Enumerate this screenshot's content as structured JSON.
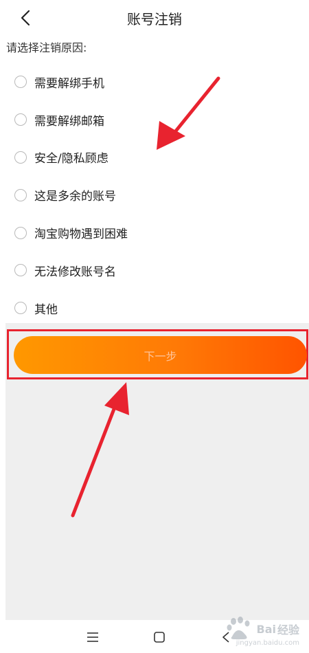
{
  "header": {
    "title": "账号注销",
    "back_icon": "chevron-left-icon"
  },
  "prompt": "请选择注销原因:",
  "options": [
    {
      "label": "需要解绑手机",
      "selected": false
    },
    {
      "label": "需要解绑邮箱",
      "selected": false
    },
    {
      "label": "安全/隐私顾虑",
      "selected": false
    },
    {
      "label": "这是多余的账号",
      "selected": false
    },
    {
      "label": "淘宝购物遇到困难",
      "selected": false
    },
    {
      "label": "无法修改账号名",
      "selected": false
    },
    {
      "label": "其他",
      "selected": false
    }
  ],
  "next_button": {
    "label": "下一步"
  },
  "colors": {
    "button_gradient_start": "#ff9800",
    "button_gradient_end": "#ff5400",
    "annotation_red": "#e8232f",
    "background_gray": "#efefef"
  },
  "navbar": {
    "menu_icon": "menu-icon",
    "home_icon": "home-square-icon",
    "back_icon": "back-triangle-icon"
  },
  "watermark": {
    "brand": "Bai",
    "brand_cn": "经验",
    "url": "jingyan.baidu.com"
  }
}
